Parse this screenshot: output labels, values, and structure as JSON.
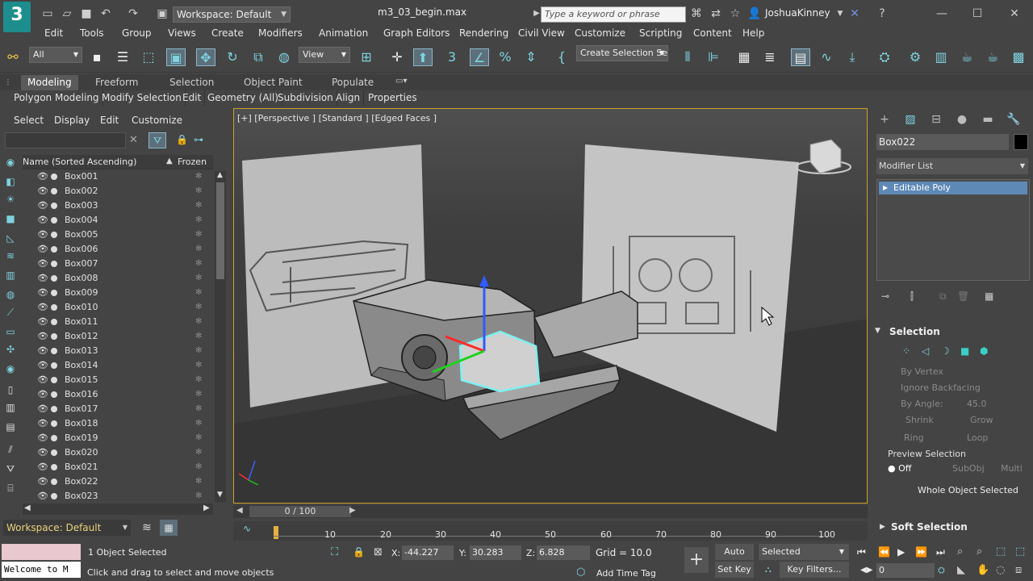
{
  "app": {
    "logo_text": "3",
    "workspace": "Workspace: Default",
    "document_title": "m3_03_begin.max",
    "search_placeholder": "Type a keyword or phrase",
    "user": "JoshuaKinney"
  },
  "menu": [
    "Edit",
    "Tools",
    "Group",
    "Views",
    "Create",
    "Modifiers",
    "Animation",
    "Graph Editors",
    "Rendering",
    "Civil View",
    "Customize",
    "Scripting",
    "Content",
    "Help"
  ],
  "toolbar": {
    "filter": "All",
    "ref_coord": "View",
    "selection_set": "Create Selection Se"
  },
  "ribbon": {
    "tabs": [
      "Modeling",
      "Freeform",
      "Selection",
      "Object Paint",
      "Populate"
    ],
    "sub": [
      "Polygon Modeling",
      "Modify Selection",
      "Edit",
      "Geometry (All)",
      "Subdivision",
      "Align",
      "Properties"
    ]
  },
  "explorer": {
    "menu": [
      "Select",
      "Display",
      "Edit",
      "Customize"
    ],
    "col_name": "Name (Sorted Ascending)",
    "col_frozen": "Frozen",
    "rows": [
      "Box001",
      "Box002",
      "Box003",
      "Box004",
      "Box005",
      "Box006",
      "Box007",
      "Box008",
      "Box009",
      "Box010",
      "Box011",
      "Box012",
      "Box013",
      "Box014",
      "Box015",
      "Box016",
      "Box017",
      "Box018",
      "Box019",
      "Box020",
      "Box021",
      "Box022",
      "Box023"
    ],
    "workspace": "Workspace: Default"
  },
  "viewport": {
    "label": "[+] [Perspective ] [Standard ] [Edged Faces ]"
  },
  "command_panel": {
    "object_name": "Box022",
    "modifier_list": "Modifier List",
    "modifier": "Editable Poly",
    "selection_title": "Selection",
    "by_vertex": "By Vertex",
    "ignore_backfacing": "Ignore Backfacing",
    "by_angle": "By Angle:",
    "angle_value": "45.0",
    "shrink": "Shrink",
    "grow": "Grow",
    "ring": "Ring",
    "loop": "Loop",
    "preview_selection": "Preview Selection",
    "off": "Off",
    "subobj": "SubObj",
    "multi": "Multi",
    "whole_object": "Whole Object Selected",
    "soft_selection": "Soft Selection"
  },
  "timeline": {
    "label": "0 / 100",
    "ticks": [
      "10",
      "20",
      "30",
      "40",
      "50",
      "60",
      "70",
      "80",
      "90",
      "100"
    ]
  },
  "status": {
    "objects_selected": "1 Object Selected",
    "hint": "Click and drag to select and move objects",
    "maxscript": "Welcome to M",
    "x_label": "X:",
    "x": "-44.227",
    "y_label": "Y:",
    "y": "30.283",
    "z_label": "Z:",
    "z": "6.828",
    "grid": "Grid = 10.0",
    "add_time_tag": "Add Time Tag",
    "auto_key": "Auto Key",
    "selected": "Selected",
    "set_key": "Set Key",
    "key_filters": "Key Filters...",
    "frame": "0"
  }
}
